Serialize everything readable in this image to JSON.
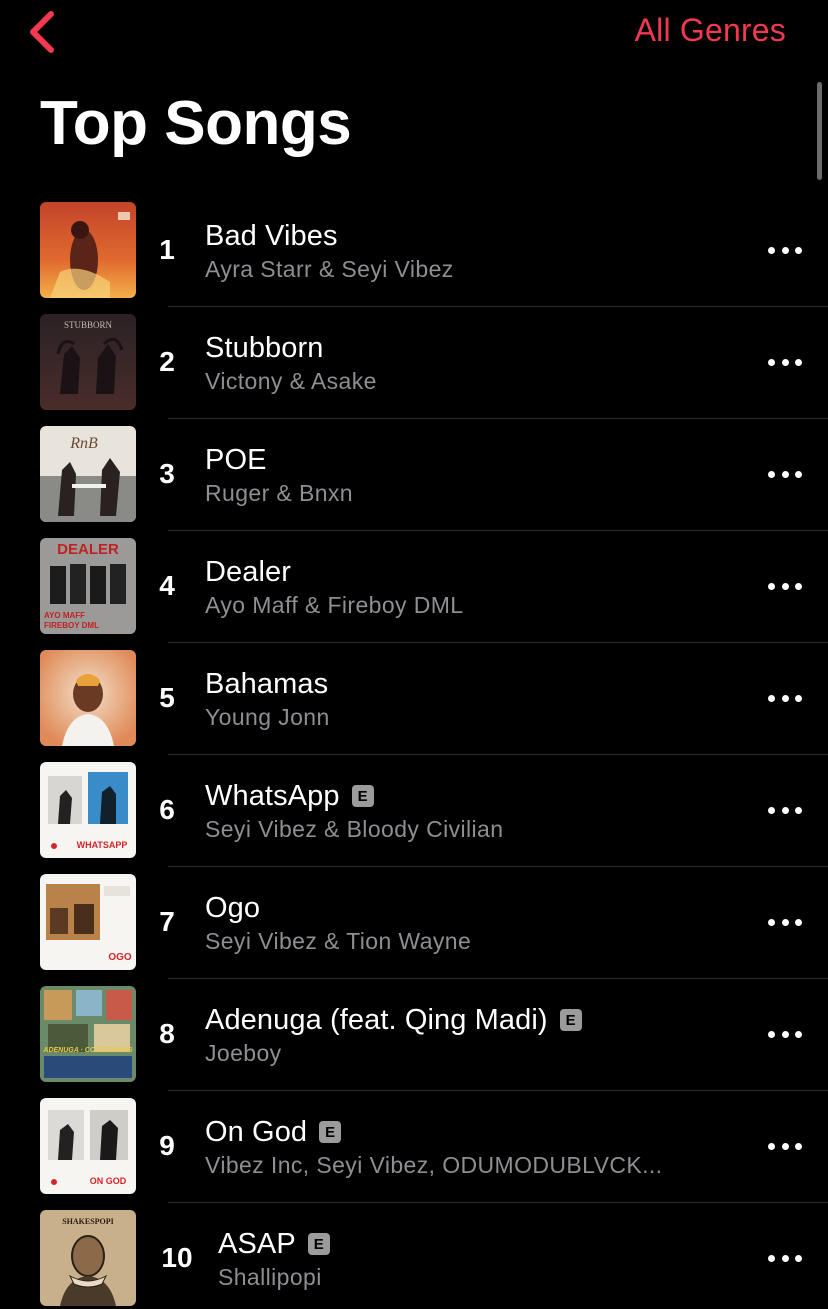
{
  "nav": {
    "back_icon": "chevron-left-icon",
    "genres_label": "All Genres",
    "accent_color": "#f2394f"
  },
  "page": {
    "title": "Top Songs"
  },
  "explicit_badge": "E",
  "songs": [
    {
      "rank": "1",
      "title": "Bad Vibes",
      "artist": "Ayra Starr & Seyi Vibez",
      "explicit": false
    },
    {
      "rank": "2",
      "title": "Stubborn",
      "artist": "Victony & Asake",
      "explicit": false
    },
    {
      "rank": "3",
      "title": "POE",
      "artist": "Ruger & Bnxn",
      "explicit": false
    },
    {
      "rank": "4",
      "title": "Dealer",
      "artist": "Ayo Maff & Fireboy DML",
      "explicit": false
    },
    {
      "rank": "5",
      "title": "Bahamas",
      "artist": "Young Jonn",
      "explicit": false
    },
    {
      "rank": "6",
      "title": "WhatsApp",
      "artist": "Seyi Vibez & Bloody Civilian",
      "explicit": true
    },
    {
      "rank": "7",
      "title": "Ogo",
      "artist": "Seyi Vibez & Tion Wayne",
      "explicit": false
    },
    {
      "rank": "8",
      "title": "Adenuga (feat. Qing Madi)",
      "artist": "Joeboy",
      "explicit": true
    },
    {
      "rank": "9",
      "title": "On God",
      "artist": "Vibez Inc, Seyi Vibez, ODUMODUBLVCK...",
      "explicit": true
    },
    {
      "rank": "10",
      "title": "ASAP",
      "artist": "Shallipopi",
      "explicit": true
    }
  ],
  "artwork": {
    "stubborn_text": "STUBBORN",
    "rnb_text": "RnB",
    "dealer_text": "DEALER",
    "dealer_artists": "AYO MAFF",
    "dealer_artists_2": "FIREBOY DML",
    "whatsapp_text": "WHATSAPP",
    "ogo_text": "OGO",
    "adenuga_text": "ADENUGA · CONCERNING",
    "ongod_text": "ON GOD",
    "shakespopi_text": "SHAKESPOPI"
  }
}
